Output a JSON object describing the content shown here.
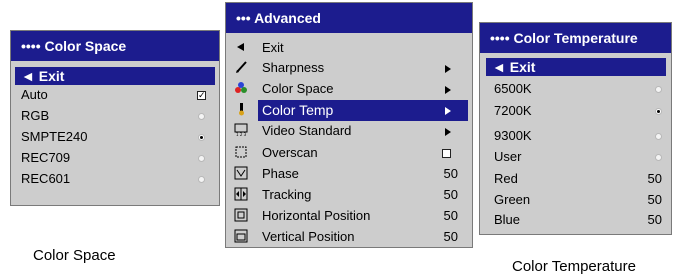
{
  "color_space": {
    "title": "•••• Color Space",
    "exit": "◄ Exit",
    "items": [
      {
        "label": "Auto",
        "control": "checkbox",
        "checked": true
      },
      {
        "label": "RGB",
        "control": "radio",
        "selected": false
      },
      {
        "label": "SMPTE240",
        "control": "radio",
        "selected": true
      },
      {
        "label": "REC709",
        "control": "radio",
        "selected": false
      },
      {
        "label": "REC601",
        "control": "radio",
        "selected": false
      }
    ]
  },
  "advanced": {
    "title": "••• Advanced",
    "items": [
      {
        "label": "Exit",
        "icon": "back-arrow-icon"
      },
      {
        "label": "Sharpness",
        "icon": "pen-icon",
        "submenu": true
      },
      {
        "label": "Color Space",
        "icon": "color-dots-icon",
        "submenu": true
      },
      {
        "label": "Color Temp",
        "icon": "thermometer-icon",
        "submenu": true,
        "highlighted": true
      },
      {
        "label": "Video Standard",
        "icon": "video-standard-icon",
        "submenu": true
      },
      {
        "label": "Overscan",
        "icon": "overscan-icon",
        "toggle": true
      },
      {
        "label": "Phase",
        "icon": "phase-icon",
        "value": "50"
      },
      {
        "label": "Tracking",
        "icon": "tracking-icon",
        "value": "50"
      },
      {
        "label": "Horizontal Position",
        "icon": "horizontal-position-icon",
        "value": "50"
      },
      {
        "label": "Vertical Position",
        "icon": "vertical-position-icon",
        "value": "50"
      }
    ]
  },
  "color_temperature": {
    "title": "•••• Color Temperature",
    "exit": "◄ Exit",
    "items": [
      {
        "label": "6500K",
        "control": "radio",
        "selected": false
      },
      {
        "label": "7200K",
        "control": "radio",
        "selected": true
      },
      {
        "label": "9300K",
        "control": "radio",
        "selected": false
      },
      {
        "label": "User",
        "control": "radio",
        "selected": false
      },
      {
        "label": "Red",
        "value": "50"
      },
      {
        "label": "Green",
        "value": "50"
      },
      {
        "label": "Blue",
        "value": "50"
      }
    ]
  },
  "captions": {
    "left": "Color Space",
    "right": "Color Temperature"
  },
  "colors": {
    "title_bar": "#1c1c8e",
    "panel": "#cdcdcd"
  }
}
